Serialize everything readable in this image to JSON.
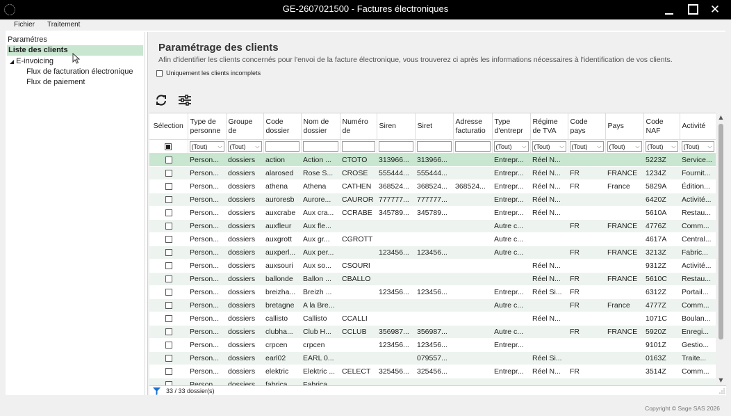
{
  "window": {
    "title": "GE-2607021500 - Factures électroniques",
    "minimize_symbol": "_",
    "close_symbol": "✕"
  },
  "menu": {
    "items": [
      "Fichier",
      "Traitement"
    ]
  },
  "tree": {
    "items": [
      {
        "label": "Paramétres"
      },
      {
        "label": "Liste des clients",
        "selected": true
      },
      {
        "label": "E-invoicing",
        "expanded": true
      },
      {
        "label": "Flux de facturation électronique"
      },
      {
        "label": "Flux de paiement"
      }
    ]
  },
  "page": {
    "title": "Paramétrage des clients",
    "description": "Afin d'identifier les clients concernés pour l'envoi de la facture électronique, vous trouverez ci après les informations nécessaires à l'identification de vos clients.",
    "incomplete_label": "Uniquement les clients incomplets"
  },
  "icons": {
    "refresh": "refresh-icon",
    "settings": "filter-settings-icon",
    "funnel": "funnel-icon"
  },
  "grid": {
    "columns": [
      {
        "key": "sel",
        "label": "Sélection"
      },
      {
        "key": "type_personne",
        "label": "Type de\npersonne"
      },
      {
        "key": "groupe",
        "label": "Groupe\nde"
      },
      {
        "key": "code_dossier",
        "label": "Code\ndossier"
      },
      {
        "key": "nom_dossier",
        "label": "Nom de\ndossier"
      },
      {
        "key": "numero",
        "label": "Numéro\nde"
      },
      {
        "key": "siren",
        "label": "Siren"
      },
      {
        "key": "siret",
        "label": "Siret"
      },
      {
        "key": "adresse",
        "label": "Adresse\nfacturatio"
      },
      {
        "key": "type_entrep",
        "label": "Type\nd'entrepr"
      },
      {
        "key": "regime",
        "label": "Régime\nde TVA"
      },
      {
        "key": "code_pays",
        "label": "Code\npays"
      },
      {
        "key": "pays",
        "label": "Pays"
      },
      {
        "key": "code_naf",
        "label": "Code\nNAF"
      },
      {
        "key": "activite",
        "label": "Activité"
      }
    ],
    "filters": [
      "",
      "(Tout)",
      "(Tout)",
      "",
      "",
      "",
      "",
      "",
      "",
      "(Tout)",
      "(Tout)",
      "(Tout)",
      "(Tout)",
      "(Tout)",
      "(Tout)"
    ],
    "rows": [
      [
        "",
        "Person...",
        "dossiers",
        "action",
        "Action ...",
        "CTOTO",
        "313966...",
        "313966...",
        "",
        "Entrepr...",
        "Réel N...",
        "",
        "",
        "5223Z",
        "Service..."
      ],
      [
        "",
        "Person...",
        "dossiers",
        "alarosed",
        "Rose S...",
        "CROSE",
        "555444...",
        "555444...",
        "",
        "Entrepr...",
        "Réel N...",
        "FR",
        "FRANCE",
        "1234Z",
        "Fournit..."
      ],
      [
        "",
        "Person...",
        "dossiers",
        "athena",
        "Athena",
        "CATHEN",
        "368524...",
        "368524...",
        "368524...",
        "Entrepr...",
        "Réel N...",
        "FR",
        "France",
        "5829A",
        "Édition..."
      ],
      [
        "",
        "Person...",
        "dossiers",
        "auroresb",
        "Aurore...",
        "CAUROR",
        "777777...",
        "777777...",
        "",
        "Entrepr...",
        "Réel N...",
        "",
        "",
        "6420Z",
        "Activité..."
      ],
      [
        "",
        "Person...",
        "dossiers",
        "auxcrabe",
        "Aux cra...",
        "CCRABE",
        "345789...",
        "345789...",
        "",
        "Entrepr...",
        "Réel N...",
        "",
        "",
        "5610A",
        "Restau..."
      ],
      [
        "",
        "Person...",
        "dossiers",
        "auxfleur",
        "Aux fle...",
        "",
        "",
        "",
        "",
        "Autre c...",
        "",
        "FR",
        "FRANCE",
        "4776Z",
        "Comm..."
      ],
      [
        "",
        "Person...",
        "dossiers",
        "auxgrott",
        "Aux gr...",
        "CGROTT",
        "",
        "",
        "",
        "Autre c...",
        "",
        "",
        "",
        "4617A",
        "Central..."
      ],
      [
        "",
        "Person...",
        "dossiers",
        "auxperl...",
        "Aux per...",
        "",
        "123456...",
        "123456...",
        "",
        "Autre c...",
        "",
        "FR",
        "FRANCE",
        "3213Z",
        "Fabric..."
      ],
      [
        "",
        "Person...",
        "dossiers",
        "auxsouri",
        "Aux so...",
        "CSOURI",
        "",
        "",
        "",
        "",
        "Réel N...",
        "",
        "",
        "9312Z",
        "Activité..."
      ],
      [
        "",
        "Person...",
        "dossiers",
        "ballonde",
        "Ballon ...",
        "CBALLO",
        "",
        "",
        "",
        "",
        "Réel N...",
        "FR",
        "FRANCE",
        "5610C",
        "Restau..."
      ],
      [
        "",
        "Person...",
        "dossiers",
        "breizha...",
        "Breizh ...",
        "",
        "123456...",
        "123456...",
        "",
        "Entrepr...",
        "Réel Si...",
        "FR",
        "",
        "6312Z",
        "Portail..."
      ],
      [
        "",
        "Person...",
        "dossiers",
        "bretagne",
        "A la Bre...",
        "",
        "",
        "",
        "",
        "Autre c...",
        "",
        "FR",
        "France",
        "4777Z",
        "Comm..."
      ],
      [
        "",
        "Person...",
        "dossiers",
        "callisto",
        "Callisto",
        "CCALLI",
        "",
        "",
        "",
        "",
        "Réel N...",
        "",
        "",
        "1071C",
        "Boulan..."
      ],
      [
        "",
        "Person...",
        "dossiers",
        "clubha...",
        "Club H...",
        "CCLUB",
        "356987...",
        "356987...",
        "",
        "Autre c...",
        "",
        "FR",
        "FRANCE",
        "5920Z",
        "Enregi..."
      ],
      [
        "",
        "Person...",
        "dossiers",
        "crpcen",
        "crpcen",
        "",
        "123456...",
        "123456...",
        "",
        "Entrepr...",
        "",
        "",
        "",
        "9101Z",
        "Gestio..."
      ],
      [
        "",
        "Person...",
        "dossiers",
        "earl02",
        "EARL 0...",
        "",
        "",
        "079557...",
        "",
        "",
        "Réel Si...",
        "",
        "",
        "0163Z",
        "Traite..."
      ],
      [
        "",
        "Person...",
        "dossiers",
        "elektric",
        "Elektric ...",
        "CELECT",
        "325456...",
        "325456...",
        "",
        "Entrepr...",
        "Réel N...",
        "FR",
        "",
        "3514Z",
        "Comm..."
      ],
      [
        "",
        "Person...",
        "dossiers",
        "fabrica",
        "Fabrica...",
        "",
        "",
        "",
        "",
        "",
        "",
        "",
        "",
        "",
        ""
      ]
    ]
  },
  "status": {
    "count": "33 / 33 dossier(s)"
  },
  "footer": {
    "copyright": "Copyright © Sage SAS 2026"
  },
  "colors": {
    "titlebar": "#000000",
    "selected_row": "#c9e6d0",
    "alt_row": "#edf4ef",
    "funnel_blue": "#1a6fd0"
  }
}
